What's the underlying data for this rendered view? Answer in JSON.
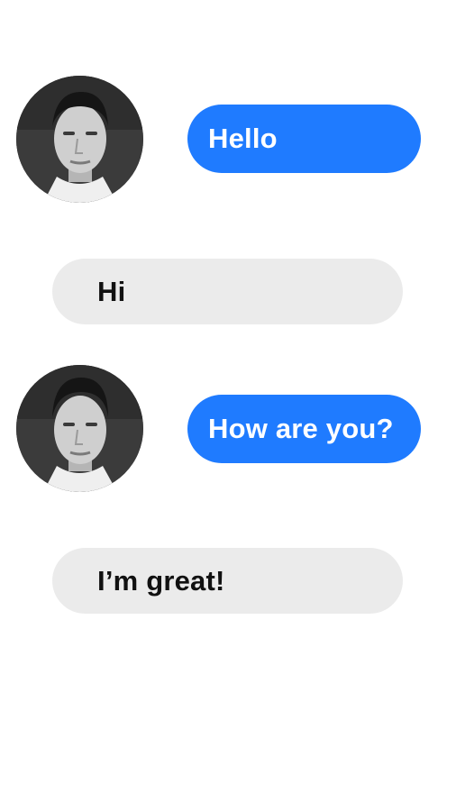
{
  "messages": [
    {
      "direction": "sent",
      "text": "Hello",
      "avatar": "profile-photo"
    },
    {
      "direction": "received",
      "text": "Hi"
    },
    {
      "direction": "sent",
      "text": "How are you?",
      "avatar": "profile-photo"
    },
    {
      "direction": "received",
      "text": "I’m great!"
    }
  ],
  "colors": {
    "sent_bubble": "#1f7bff",
    "received_bubble": "#ebebeb",
    "sent_text": "#ffffff",
    "received_text": "#111111"
  }
}
